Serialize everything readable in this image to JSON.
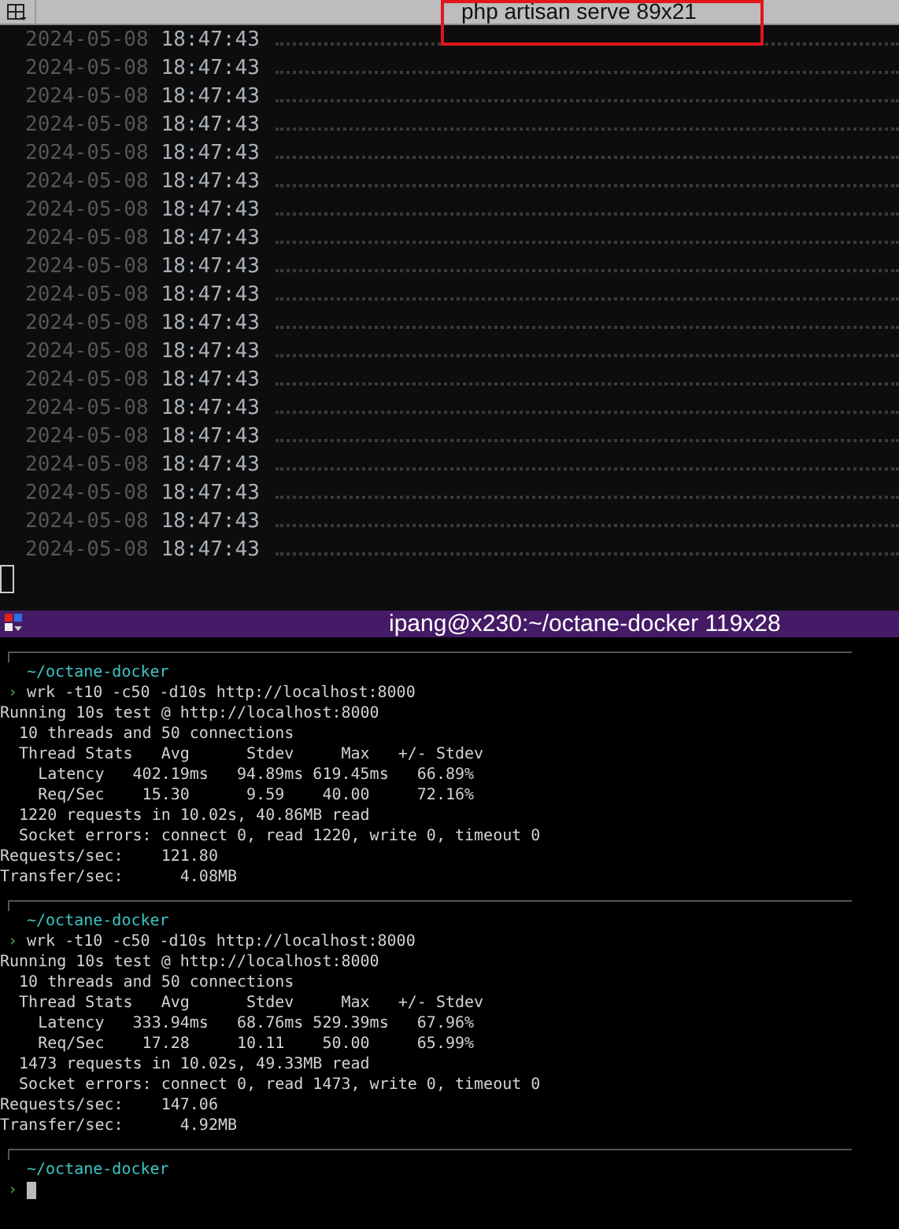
{
  "top_window": {
    "title": "php artisan serve 89x21",
    "lines": [
      {
        "date": "2024-05-08",
        "time": "18:47:43"
      },
      {
        "date": "2024-05-08",
        "time": "18:47:43"
      },
      {
        "date": "2024-05-08",
        "time": "18:47:43"
      },
      {
        "date": "2024-05-08",
        "time": "18:47:43"
      },
      {
        "date": "2024-05-08",
        "time": "18:47:43"
      },
      {
        "date": "2024-05-08",
        "time": "18:47:43"
      },
      {
        "date": "2024-05-08",
        "time": "18:47:43"
      },
      {
        "date": "2024-05-08",
        "time": "18:47:43"
      },
      {
        "date": "2024-05-08",
        "time": "18:47:43"
      },
      {
        "date": "2024-05-08",
        "time": "18:47:43"
      },
      {
        "date": "2024-05-08",
        "time": "18:47:43"
      },
      {
        "date": "2024-05-08",
        "time": "18:47:43"
      },
      {
        "date": "2024-05-08",
        "time": "18:47:43"
      },
      {
        "date": "2024-05-08",
        "time": "18:47:43"
      },
      {
        "date": "2024-05-08",
        "time": "18:47:43"
      },
      {
        "date": "2024-05-08",
        "time": "18:47:43"
      },
      {
        "date": "2024-05-08",
        "time": "18:47:43"
      },
      {
        "date": "2024-05-08",
        "time": "18:47:43"
      },
      {
        "date": "2024-05-08",
        "time": "18:47:43"
      }
    ]
  },
  "bottom_window": {
    "title": "ipang@x230:~/octane-docker 119x28",
    "blocks": [
      {
        "cwd": "~/octane-docker",
        "prompt": "›",
        "command": "wrk -t10 -c50 -d10s http://localhost:8000",
        "output": [
          "Running 10s test @ http://localhost:8000",
          "  10 threads and 50 connections",
          "  Thread Stats   Avg      Stdev     Max   +/- Stdev",
          "    Latency   402.19ms   94.89ms 619.45ms   66.89%",
          "    Req/Sec    15.30      9.59    40.00     72.16%",
          "  1220 requests in 10.02s, 40.86MB read",
          "  Socket errors: connect 0, read 1220, write 0, timeout 0",
          "Requests/sec:    121.80",
          "Transfer/sec:      4.08MB"
        ]
      },
      {
        "cwd": "~/octane-docker",
        "prompt": "›",
        "command": "wrk -t10 -c50 -d10s http://localhost:8000",
        "output": [
          "Running 10s test @ http://localhost:8000",
          "  10 threads and 50 connections",
          "  Thread Stats   Avg      Stdev     Max   +/- Stdev",
          "    Latency   333.94ms   68.76ms 529.39ms   67.96%",
          "    Req/Sec    17.28     10.11    50.00     65.99%",
          "  1473 requests in 10.02s, 49.33MB read",
          "  Socket errors: connect 0, read 1473, write 0, timeout 0",
          "Requests/sec:    147.06",
          "Transfer/sec:      4.92MB"
        ]
      }
    ],
    "current": {
      "cwd": "~/octane-docker",
      "prompt": "›"
    }
  }
}
